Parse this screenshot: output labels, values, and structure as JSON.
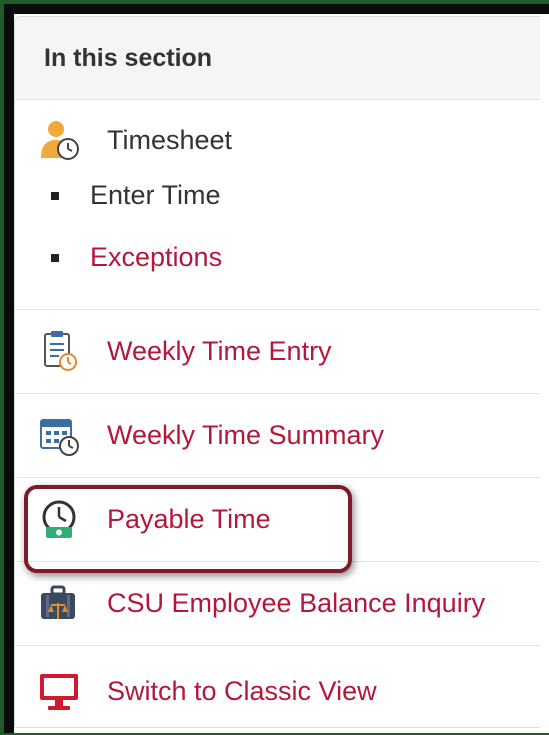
{
  "section": {
    "title": "In this section",
    "timesheet": {
      "label": "Timesheet",
      "icon": "timesheet-person-clock-icon",
      "subitems": [
        {
          "label": "Enter Time",
          "color": "#333333"
        },
        {
          "label": "Exceptions",
          "color": "#b5173a"
        }
      ]
    },
    "links": [
      {
        "label": "Weekly Time Entry",
        "icon": "clipboard-clock-icon"
      },
      {
        "label": "Weekly Time Summary",
        "icon": "calendar-clock-icon"
      },
      {
        "label": "Payable Time",
        "icon": "clock-money-icon",
        "highlighted": true
      },
      {
        "label": "CSU Employee Balance Inquiry",
        "icon": "briefcase-scale-icon"
      },
      {
        "label": "Switch to Classic View",
        "icon": "monitor-icon"
      }
    ]
  },
  "colors": {
    "link": "#b5173a",
    "text": "#333333",
    "highlight_border": "#7e1a2a",
    "outer_frame": "#1f5a2c"
  }
}
